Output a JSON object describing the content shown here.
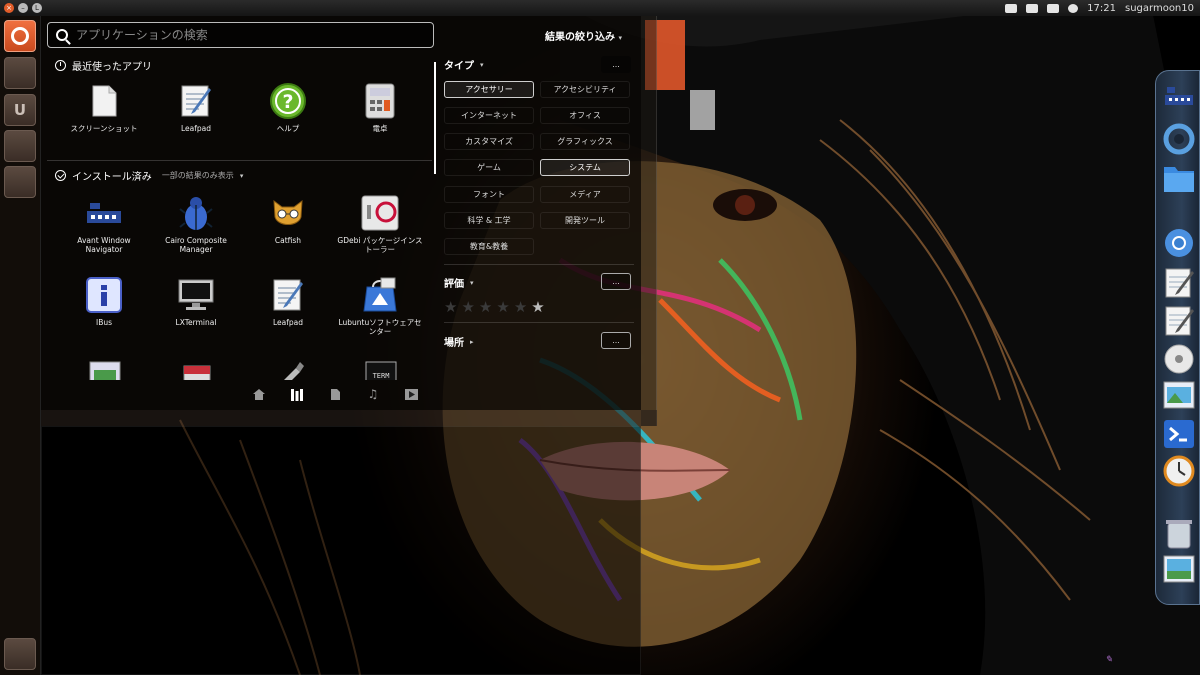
{
  "top_panel": {
    "time": "17:21",
    "user": "sugarmoon10"
  },
  "search": {
    "placeholder": "アプリケーションの検索"
  },
  "sections": {
    "recent": {
      "title": "最近使ったアプリ",
      "apps": [
        {
          "label": "スクリーンショット",
          "icon": "document-icon"
        },
        {
          "label": "Leafpad",
          "icon": "leafpad-icon"
        },
        {
          "label": "ヘルプ",
          "icon": "help-icon"
        },
        {
          "label": "電卓",
          "icon": "calculator-icon"
        }
      ]
    },
    "installed": {
      "title": "インストール済み",
      "subnote": "一部の結果のみ表示",
      "apps": [
        {
          "label": "Avant Window Navigator",
          "icon": "network-icon"
        },
        {
          "label": "Cairo Composite Manager",
          "icon": "beetle-icon"
        },
        {
          "label": "Catfish",
          "icon": "catfish-icon"
        },
        {
          "label": "GDebi パッケージインストーラー",
          "icon": "gdebi-icon"
        },
        {
          "label": "IBus",
          "icon": "info-icon"
        },
        {
          "label": "LXTerminal",
          "icon": "monitor-icon"
        },
        {
          "label": "Leafpad",
          "icon": "leafpad-icon"
        },
        {
          "label": "Lubuntuソフトウェアセンター",
          "icon": "software-center-icon"
        }
      ]
    }
  },
  "filters": {
    "title": "結果の絞り込み",
    "type_label": "タイプ",
    "all_label": "...",
    "categories": [
      {
        "label": "アクセサリー",
        "active": true
      },
      {
        "label": "アクセシビリティ",
        "active": false
      },
      {
        "label": "インターネット",
        "active": false
      },
      {
        "label": "オフィス",
        "active": false
      },
      {
        "label": "カスタマイズ",
        "active": false
      },
      {
        "label": "グラフィックス",
        "active": false
      },
      {
        "label": "ゲーム",
        "active": false
      },
      {
        "label": "システム",
        "active": true
      },
      {
        "label": "フォント",
        "active": false
      },
      {
        "label": "メディア",
        "active": false
      },
      {
        "label": "科学 & 工学",
        "active": false
      },
      {
        "label": "開発ツール",
        "active": false
      },
      {
        "label": "教育&教養",
        "active": false
      }
    ],
    "rating_label": "評価",
    "location_label": "場所"
  },
  "scopes": [
    "home-icon",
    "applications-icon",
    "files-icon",
    "music-icon",
    "video-icon"
  ],
  "launcher": {
    "items": [
      "dash-home",
      "workspace-1",
      "unity-letter",
      "workspace-2",
      "workspace-3",
      "trash"
    ]
  },
  "dock": {
    "items": [
      "network-manager-icon",
      "swirl-icon",
      "folder-icon",
      "chromium-icon",
      "text-editor-icon",
      "text-editor-icon",
      "disc-icon",
      "image-viewer-icon",
      "terminal-icon",
      "clock-icon",
      "trash-icon",
      "photo-icon"
    ]
  },
  "colors": {
    "accent": "#e25d2a",
    "dash_bg": "#0a0806",
    "dock_border": "#5a7390"
  }
}
